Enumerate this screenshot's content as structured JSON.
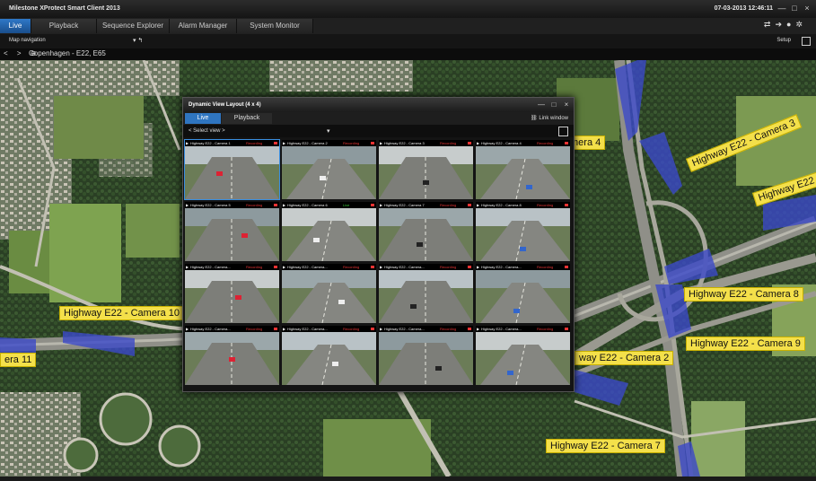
{
  "app": {
    "title": "Milestone XProtect Smart Client 2013",
    "datetime": "07-03-2013 12:46:11",
    "window_controls": [
      "—",
      "□",
      "×"
    ]
  },
  "tabs": [
    {
      "label": "Live",
      "active": true
    },
    {
      "label": "Playback",
      "active": false
    },
    {
      "label": "Sequence Explorer",
      "active": false
    },
    {
      "label": "Alarm Manager",
      "active": false
    },
    {
      "label": "System Monitor",
      "active": false
    }
  ],
  "toolbar": {
    "map_navigation": "Map navigation",
    "setup": "Setup"
  },
  "breadcrumb": {
    "location": "Copenhagen - E22, E65"
  },
  "map_labels": [
    {
      "label": "mera 4"
    },
    {
      "label": "Highway E22 - Camera 3"
    },
    {
      "label": "Highway E22 - C"
    },
    {
      "label": "Highway E22 - Camera 10"
    },
    {
      "label": "era 11"
    },
    {
      "label": "Highway E22 - Camera 8"
    },
    {
      "label": "Highway E22 - Camera 9"
    },
    {
      "label": "way E22 - Camera 2"
    },
    {
      "label": "Highway E22 - Camera 7"
    }
  ],
  "dynamic_view": {
    "title": "Dynamic View Layout (4 x 4)",
    "tabs": [
      {
        "label": "Live",
        "active": true
      },
      {
        "label": "Playback",
        "active": false
      }
    ],
    "link_window": "Link window",
    "select_view": "< Select view >",
    "cameras": [
      {
        "name": "Highway E22 - Camera 1",
        "status": "Recording"
      },
      {
        "name": "Highway E22 - Camera 2",
        "status": "Recording"
      },
      {
        "name": "Highway E22 - Camera 3",
        "status": "Recording"
      },
      {
        "name": "Highway E22 - Camera 4",
        "status": "Recording"
      },
      {
        "name": "Highway E22 - Camera 5",
        "status": "Recording"
      },
      {
        "name": "Highway E22 - Camera 6",
        "status": "Live"
      },
      {
        "name": "Highway E22 - Camera 7",
        "status": "Recording"
      },
      {
        "name": "Highway E22 - Camera 8",
        "status": "Recording"
      },
      {
        "name": "Highway E22 - Camera...",
        "status": "Recording"
      },
      {
        "name": "Highway E22 - Camera...",
        "status": "Recording"
      },
      {
        "name": "Highway E22 - Camera...",
        "status": "Recording"
      },
      {
        "name": "Highway E22 - Camera...",
        "status": "Recording"
      },
      {
        "name": "Highway E22 - Camera...",
        "status": "Recording"
      },
      {
        "name": "Highway E22 - Camera...",
        "status": "Recording"
      },
      {
        "name": "Highway E22 - Camera...",
        "status": "Recording"
      },
      {
        "name": "Highway E22 - Camera...",
        "status": "Recording"
      }
    ]
  },
  "colors": {
    "accent": "#2f78c8",
    "label_bg": "#f4e04a",
    "recording": "#e33333",
    "live": "#3ccf3c",
    "fov_cone": "#3b49c8"
  }
}
